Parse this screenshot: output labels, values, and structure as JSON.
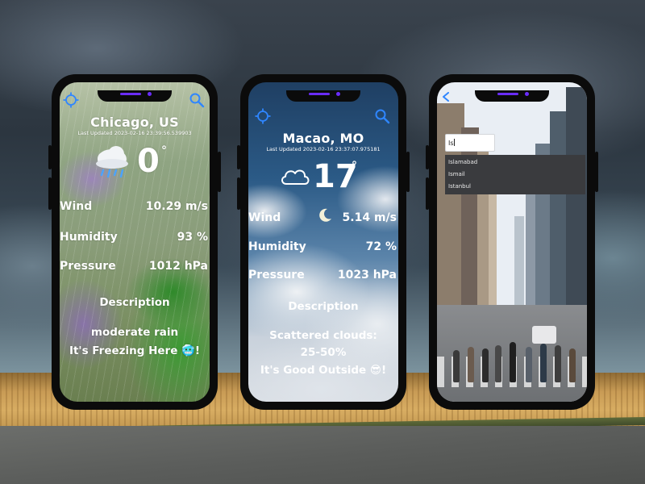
{
  "phones": [
    {
      "city": "Chicago, US",
      "last_updated": "Last Updated 2023-02-16 23:39:56.539903",
      "temp": "0",
      "degree": "°",
      "condition_icon": "rain-cloud-icon",
      "wind_label": "Wind",
      "wind_value": "10.29 m/s",
      "humidity_label": "Humidity",
      "humidity_value": "93 %",
      "pressure_label": "Pressure",
      "pressure_value": "1012 hPa",
      "description_label": "Description",
      "description": "moderate rain",
      "feeling": "It's Freezing Here 🥶!"
    },
    {
      "city": "Macao, MO",
      "last_updated": "Last Updated 2023-02-16 23:37:07.975181",
      "temp": "17",
      "degree": "°",
      "condition_icon": "cloud-icon",
      "wind_label": "Wind",
      "wind_value": "5.14 m/s",
      "humidity_label": "Humidity",
      "humidity_value": "72 %",
      "pressure_label": "Pressure",
      "pressure_value": "1023 hPa",
      "description_label": "Description",
      "description_line1": "Scattered clouds:",
      "description_line2": "25-50%",
      "feeling": "It's Good Outside 😎!"
    },
    {
      "search_value": "Is",
      "suggestions": [
        "Islamabad",
        "Ismail",
        "Istanbul"
      ]
    }
  ],
  "icons": {
    "locate": "crosshair-location-icon",
    "search": "magnifier-search-icon",
    "back": "back-arrow-icon"
  },
  "colors": {
    "accent_blue": "#2f86ff",
    "notch_purple": "#6a2cff"
  }
}
